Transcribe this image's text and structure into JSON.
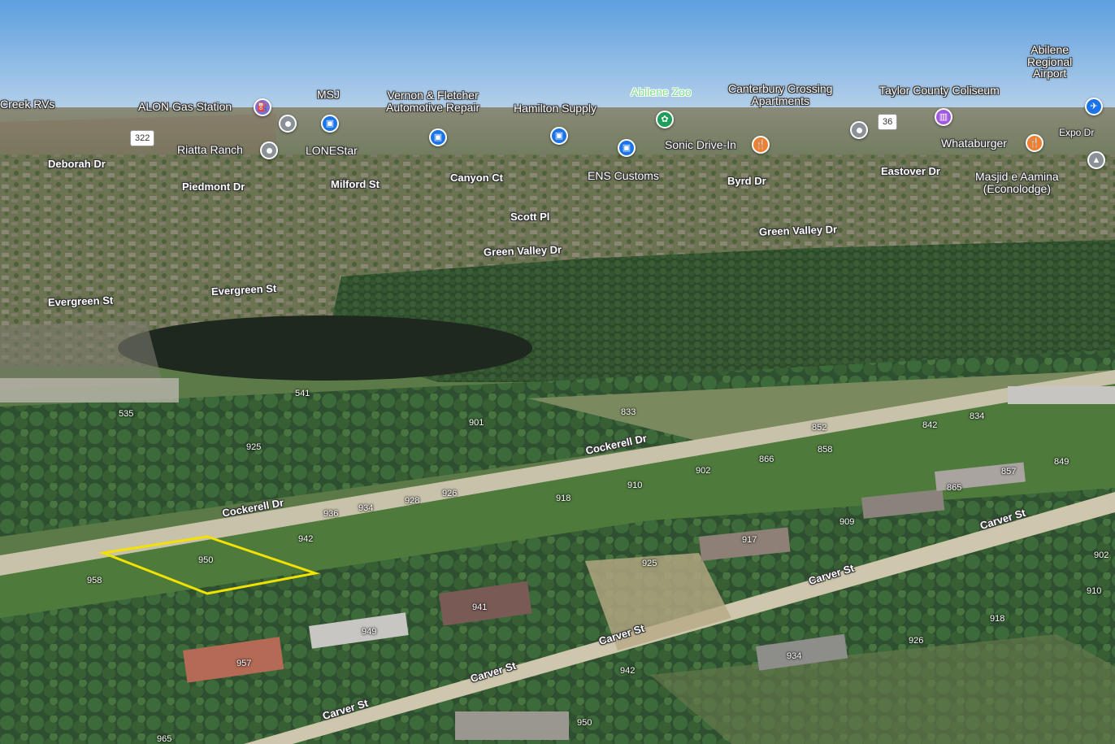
{
  "map": {
    "view": "3D satellite",
    "parcel_outline_color": "#f2e200",
    "colors": {
      "sky": "#6ea6e0",
      "shopping_pin": "#1a73e8",
      "food_pin": "#f07f30",
      "zoo_pin": "#1e9e5a",
      "venue_pin": "#a259e0",
      "gas_pin": "#7b6fd8",
      "generic_pin": "#8a9197",
      "airport_pin": "#1a73e8"
    }
  },
  "places": {
    "creek_rvs": "Creek RVs",
    "alon_gas": "ALON Gas Station",
    "msj": "MSJ",
    "vernon_fletcher": "Vernon & Fletcher\nAutomotive Repair",
    "hamilton_supply": "Hamilton Supply",
    "abilene_zoo": "Abilene Zoo",
    "canterbury": "Canterbury Crossing\nApartments",
    "taylor_coliseum": "Taylor County Coliseum",
    "abilene_airport": "Abilene\nRegional\nAirport",
    "riatta_ranch": "Riatta Ranch",
    "lonestar": "LONEStar",
    "sonic": "Sonic Drive-In",
    "whataburger": "Whataburger",
    "ens_customs": "ENS Customs",
    "masjid": "Masjid e Aamina\n(Econolodge)",
    "expo_dr": "Expo Dr"
  },
  "streets": {
    "deborah": "Deborah Dr",
    "piedmont": "Piedmont Dr",
    "milford": "Milford St",
    "canyon": "Canyon Ct",
    "byrd": "Byrd Dr",
    "eastover": "Eastover Dr",
    "scott": "Scott Pl",
    "green_valley_1": "Green Valley Dr",
    "green_valley_2": "Green Valley Dr",
    "evergreen_1": "Evergreen St",
    "evergreen_2": "Evergreen St",
    "cockerell_1": "Cockerell Dr",
    "cockerell_2": "Cockerell Dr",
    "carver_1": "Carver St",
    "carver_2": "Carver St",
    "carver_3": "Carver St",
    "carver_4": "Carver St",
    "carver_5": "Carver St"
  },
  "shields": {
    "route_322": "322",
    "route_36": "36"
  },
  "icons": {
    "gas": "gas-station-icon",
    "shopping": "shopping-bag-icon",
    "food": "fork-knife-icon",
    "zoo": "paw-icon",
    "venue": "venue-icon",
    "airport": "airplane-icon",
    "generic": "place-pin-icon",
    "school": "school-icon"
  },
  "addresses": [
    "541",
    "535",
    "901",
    "925",
    "833",
    "852",
    "842",
    "834",
    "858",
    "866",
    "857",
    "849",
    "902",
    "910",
    "918",
    "926",
    "928",
    "934",
    "936",
    "942",
    "950",
    "958",
    "865",
    "909",
    "917",
    "925",
    "902",
    "910",
    "918",
    "926",
    "941",
    "949",
    "957",
    "934",
    "942",
    "950",
    "965"
  ]
}
